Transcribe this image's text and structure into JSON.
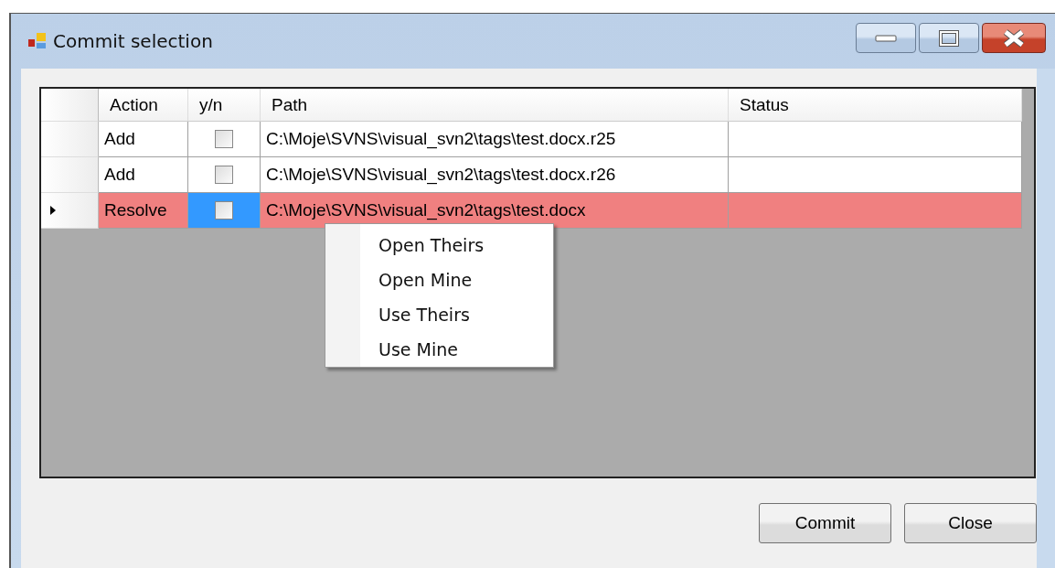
{
  "window": {
    "title": "Commit selection"
  },
  "table": {
    "columns": [
      "Action",
      "y/n",
      "Path",
      "Status"
    ],
    "rows": [
      {
        "action": "Add",
        "checked": false,
        "path": "C:\\Moje\\SVNS\\visual_svn2\\tags\\test.docx.r25",
        "selected": false,
        "highlighted": false
      },
      {
        "action": "Add",
        "checked": false,
        "path": "C:\\Moje\\SVNS\\visual_svn2\\tags\\test.docx.r26",
        "selected": false,
        "highlighted": false
      },
      {
        "action": "Resolve",
        "checked": false,
        "path": "C:\\Moje\\SVNS\\visual_svn2\\tags\\test.docx",
        "selected": true,
        "highlighted": true
      }
    ]
  },
  "context_menu": {
    "items": [
      "Open Theirs",
      "Open Mine",
      "Use Theirs",
      "Use Mine"
    ]
  },
  "buttons": [
    "Commit",
    "Close"
  ]
}
